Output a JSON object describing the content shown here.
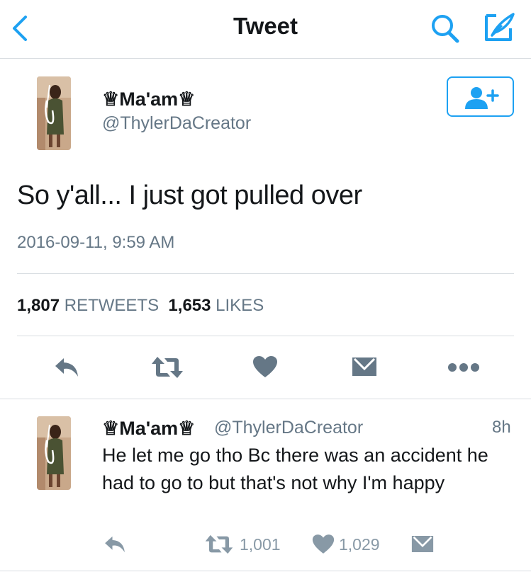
{
  "nav": {
    "title": "Tweet"
  },
  "tweet": {
    "name": "♕Ma'am♕",
    "handle": "@ThylerDaCreator",
    "text": "So y'all... I just got pulled over",
    "timestamp": "2016-09-11, 9:59 AM",
    "retweets_count": "1,807",
    "retweets_label": "RETWEETS",
    "likes_count": "1,653",
    "likes_label": "LIKES"
  },
  "reply": {
    "name": "♕Ma'am♕",
    "handle": "@ThylerDaCreator",
    "time": "8h",
    "text": "He let me go tho Bc there was an accident he had to go to but that's not why I'm happy",
    "retweet_count": "1,001",
    "like_count": "1,029"
  },
  "colors": {
    "accent": "#1da1f2",
    "icon_dark": "#657786",
    "icon_light": "#8899a6",
    "divider": "#d8dde1"
  },
  "icons": [
    "back-chevron-icon",
    "search-icon",
    "compose-icon",
    "follow-user-icon",
    "reply-icon",
    "retweet-icon",
    "heart-icon",
    "message-icon",
    "more-icon"
  ]
}
